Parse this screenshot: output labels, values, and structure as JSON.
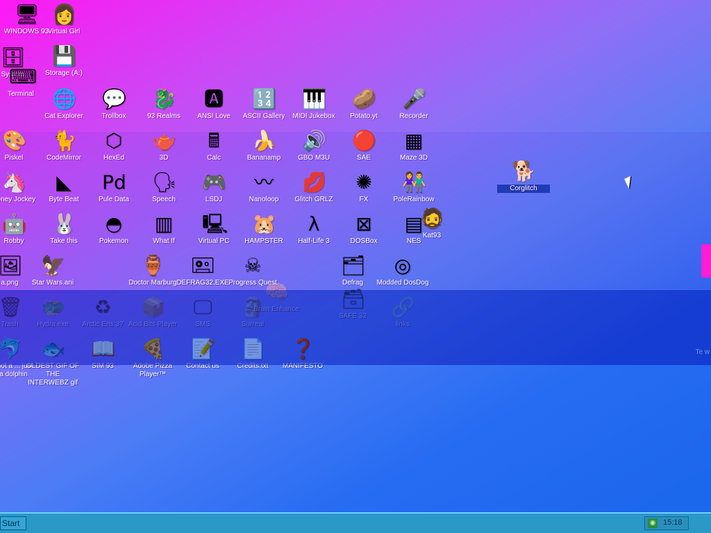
{
  "desktop": {
    "icons": [
      {
        "label": "WINDOWS 93",
        "glyph": "🖥"
      },
      {
        "label": "Virtual Girl",
        "glyph": "👩"
      },
      {
        "label": "System",
        "glyph": "🗄"
      },
      {
        "label": "Storage (A:)",
        "glyph": "💾"
      },
      {
        "label": "Terminal",
        "glyph": "⌨"
      },
      {
        "label": "Cat Explorer",
        "glyph": "🌐"
      },
      {
        "label": "Trollbox",
        "glyph": "💬"
      },
      {
        "label": "93 Realms",
        "glyph": "🐉"
      },
      {
        "label": "ANSI Love",
        "glyph": "🅰"
      },
      {
        "label": "ASCII Gallery",
        "glyph": "🔢"
      },
      {
        "label": "MIDI Jukebox",
        "glyph": "🎹"
      },
      {
        "label": "Potato.yt",
        "glyph": "🥔"
      },
      {
        "label": "Recorder",
        "glyph": "🎤"
      },
      {
        "label": "Piskel",
        "glyph": "🎨"
      },
      {
        "label": "CodeMirror",
        "glyph": "🐈"
      },
      {
        "label": "HexEd",
        "glyph": "⬡"
      },
      {
        "label": "3D",
        "glyph": "🫖"
      },
      {
        "label": "Calc",
        "glyph": "🖩"
      },
      {
        "label": "Bananamp",
        "glyph": "🍌"
      },
      {
        "label": "GBO M3U",
        "glyph": "🔊"
      },
      {
        "label": "SAE",
        "glyph": "🔴"
      },
      {
        "label": "Maze 3D",
        "glyph": "▦"
      },
      {
        "label": "Corglitch",
        "glyph": "🐕"
      },
      {
        "label": "Poney Jockey",
        "glyph": "🦄"
      },
      {
        "label": "Byte Beat",
        "glyph": "◣"
      },
      {
        "label": "Pule Data",
        "glyph": "Pd"
      },
      {
        "label": "Speech",
        "glyph": "🗣"
      },
      {
        "label": "LSDJ",
        "glyph": "🎮"
      },
      {
        "label": "Nanoloop",
        "glyph": "〰"
      },
      {
        "label": "Glitch GRLZ",
        "glyph": "💋"
      },
      {
        "label": "FX",
        "glyph": "✺"
      },
      {
        "label": "PoleRainbow",
        "glyph": "👫"
      },
      {
        "label": "Robby",
        "glyph": "🤖"
      },
      {
        "label": "Take this",
        "glyph": "🐰"
      },
      {
        "label": "Pokemon",
        "glyph": "◓"
      },
      {
        "label": "What If",
        "glyph": "▥"
      },
      {
        "label": "Virtual PC",
        "glyph": "🖳"
      },
      {
        "label": "HAMPSTER",
        "glyph": "🐹"
      },
      {
        "label": "Half-Life 3",
        "glyph": "λ"
      },
      {
        "label": "DOSBox",
        "glyph": "⊠"
      },
      {
        "label": "NES",
        "glyph": "▤"
      },
      {
        "label": "Kat93",
        "glyph": "🧔"
      },
      {
        "label": "a.png",
        "glyph": "🖼"
      },
      {
        "label": "Star Wars.ani",
        "glyph": "🦅"
      },
      {
        "label": "Doctor Marburg",
        "glyph": "🏺"
      },
      {
        "label": "DEFRAG32.EXE",
        "glyph": "🖭"
      },
      {
        "label": "Progress Quest",
        "glyph": "☠"
      },
      {
        "label": "Defrag",
        "glyph": "🗂"
      },
      {
        "label": "Modded DosDog",
        "glyph": "◎"
      },
      {
        "label": "Trash",
        "glyph": "🗑"
      },
      {
        "label": "Hydra.exe",
        "glyph": "🐲"
      },
      {
        "label": "Arctic Eris 3?",
        "glyph": "♻"
      },
      {
        "label": "Acid Bits Player",
        "glyph": "📦"
      },
      {
        "label": "SMS",
        "glyph": "🖵"
      },
      {
        "label": "Surreal",
        "glyph": "🗿"
      },
      {
        "label": "Brain Enhance",
        "glyph": "🧠"
      },
      {
        "label": "SAFE 32",
        "glyph": "🗃"
      },
      {
        "label": "links",
        "glyph": "🔗"
      },
      {
        "label": "i'm not a ... just ... a dolphin",
        "glyph": "🐬"
      },
      {
        "label": "OLDEST GIF OF THE INTERWEBZ gif",
        "glyph": "🐟"
      },
      {
        "label": "SIM 93",
        "glyph": "📖"
      },
      {
        "label": "Adobe Pizza Player™",
        "glyph": "🍕"
      },
      {
        "label": "Contact us",
        "glyph": "📝"
      },
      {
        "label": "Credits.txt",
        "glyph": "📄"
      },
      {
        "label": "MANIFESTO",
        "glyph": "❓"
      }
    ]
  },
  "taskbar": {
    "start_label": "Start",
    "tray_icon": "rss-icon",
    "tray_icon_glyph": "◉",
    "time": "15:18"
  },
  "edge": {
    "text": "Te w"
  },
  "colors": {
    "taskbar": "#2b98c8",
    "selection": "#1f3bb5",
    "gradient_start": "#ff18f4",
    "gradient_end": "#1f63e6"
  }
}
